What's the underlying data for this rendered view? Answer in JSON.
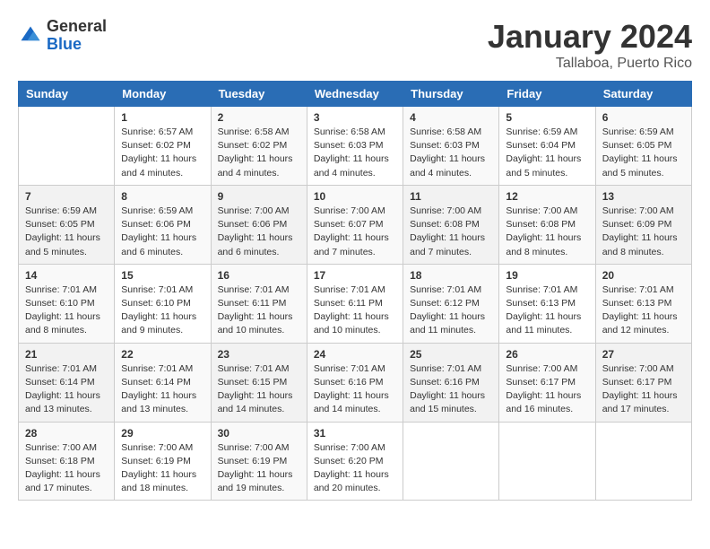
{
  "header": {
    "logo_general": "General",
    "logo_blue": "Blue",
    "month_title": "January 2024",
    "location": "Tallaboa, Puerto Rico"
  },
  "days_of_week": [
    "Sunday",
    "Monday",
    "Tuesday",
    "Wednesday",
    "Thursday",
    "Friday",
    "Saturday"
  ],
  "weeks": [
    [
      {
        "num": "",
        "info": ""
      },
      {
        "num": "1",
        "info": "Sunrise: 6:57 AM\nSunset: 6:02 PM\nDaylight: 11 hours\nand 4 minutes."
      },
      {
        "num": "2",
        "info": "Sunrise: 6:58 AM\nSunset: 6:02 PM\nDaylight: 11 hours\nand 4 minutes."
      },
      {
        "num": "3",
        "info": "Sunrise: 6:58 AM\nSunset: 6:03 PM\nDaylight: 11 hours\nand 4 minutes."
      },
      {
        "num": "4",
        "info": "Sunrise: 6:58 AM\nSunset: 6:03 PM\nDaylight: 11 hours\nand 4 minutes."
      },
      {
        "num": "5",
        "info": "Sunrise: 6:59 AM\nSunset: 6:04 PM\nDaylight: 11 hours\nand 5 minutes."
      },
      {
        "num": "6",
        "info": "Sunrise: 6:59 AM\nSunset: 6:05 PM\nDaylight: 11 hours\nand 5 minutes."
      }
    ],
    [
      {
        "num": "7",
        "info": "Sunrise: 6:59 AM\nSunset: 6:05 PM\nDaylight: 11 hours\nand 5 minutes."
      },
      {
        "num": "8",
        "info": "Sunrise: 6:59 AM\nSunset: 6:06 PM\nDaylight: 11 hours\nand 6 minutes."
      },
      {
        "num": "9",
        "info": "Sunrise: 7:00 AM\nSunset: 6:06 PM\nDaylight: 11 hours\nand 6 minutes."
      },
      {
        "num": "10",
        "info": "Sunrise: 7:00 AM\nSunset: 6:07 PM\nDaylight: 11 hours\nand 7 minutes."
      },
      {
        "num": "11",
        "info": "Sunrise: 7:00 AM\nSunset: 6:08 PM\nDaylight: 11 hours\nand 7 minutes."
      },
      {
        "num": "12",
        "info": "Sunrise: 7:00 AM\nSunset: 6:08 PM\nDaylight: 11 hours\nand 8 minutes."
      },
      {
        "num": "13",
        "info": "Sunrise: 7:00 AM\nSunset: 6:09 PM\nDaylight: 11 hours\nand 8 minutes."
      }
    ],
    [
      {
        "num": "14",
        "info": "Sunrise: 7:01 AM\nSunset: 6:10 PM\nDaylight: 11 hours\nand 8 minutes."
      },
      {
        "num": "15",
        "info": "Sunrise: 7:01 AM\nSunset: 6:10 PM\nDaylight: 11 hours\nand 9 minutes."
      },
      {
        "num": "16",
        "info": "Sunrise: 7:01 AM\nSunset: 6:11 PM\nDaylight: 11 hours\nand 10 minutes."
      },
      {
        "num": "17",
        "info": "Sunrise: 7:01 AM\nSunset: 6:11 PM\nDaylight: 11 hours\nand 10 minutes."
      },
      {
        "num": "18",
        "info": "Sunrise: 7:01 AM\nSunset: 6:12 PM\nDaylight: 11 hours\nand 11 minutes."
      },
      {
        "num": "19",
        "info": "Sunrise: 7:01 AM\nSunset: 6:13 PM\nDaylight: 11 hours\nand 11 minutes."
      },
      {
        "num": "20",
        "info": "Sunrise: 7:01 AM\nSunset: 6:13 PM\nDaylight: 11 hours\nand 12 minutes."
      }
    ],
    [
      {
        "num": "21",
        "info": "Sunrise: 7:01 AM\nSunset: 6:14 PM\nDaylight: 11 hours\nand 13 minutes."
      },
      {
        "num": "22",
        "info": "Sunrise: 7:01 AM\nSunset: 6:14 PM\nDaylight: 11 hours\nand 13 minutes."
      },
      {
        "num": "23",
        "info": "Sunrise: 7:01 AM\nSunset: 6:15 PM\nDaylight: 11 hours\nand 14 minutes."
      },
      {
        "num": "24",
        "info": "Sunrise: 7:01 AM\nSunset: 6:16 PM\nDaylight: 11 hours\nand 14 minutes."
      },
      {
        "num": "25",
        "info": "Sunrise: 7:01 AM\nSunset: 6:16 PM\nDaylight: 11 hours\nand 15 minutes."
      },
      {
        "num": "26",
        "info": "Sunrise: 7:00 AM\nSunset: 6:17 PM\nDaylight: 11 hours\nand 16 minutes."
      },
      {
        "num": "27",
        "info": "Sunrise: 7:00 AM\nSunset: 6:17 PM\nDaylight: 11 hours\nand 17 minutes."
      }
    ],
    [
      {
        "num": "28",
        "info": "Sunrise: 7:00 AM\nSunset: 6:18 PM\nDaylight: 11 hours\nand 17 minutes."
      },
      {
        "num": "29",
        "info": "Sunrise: 7:00 AM\nSunset: 6:19 PM\nDaylight: 11 hours\nand 18 minutes."
      },
      {
        "num": "30",
        "info": "Sunrise: 7:00 AM\nSunset: 6:19 PM\nDaylight: 11 hours\nand 19 minutes."
      },
      {
        "num": "31",
        "info": "Sunrise: 7:00 AM\nSunset: 6:20 PM\nDaylight: 11 hours\nand 20 minutes."
      },
      {
        "num": "",
        "info": ""
      },
      {
        "num": "",
        "info": ""
      },
      {
        "num": "",
        "info": ""
      }
    ]
  ]
}
